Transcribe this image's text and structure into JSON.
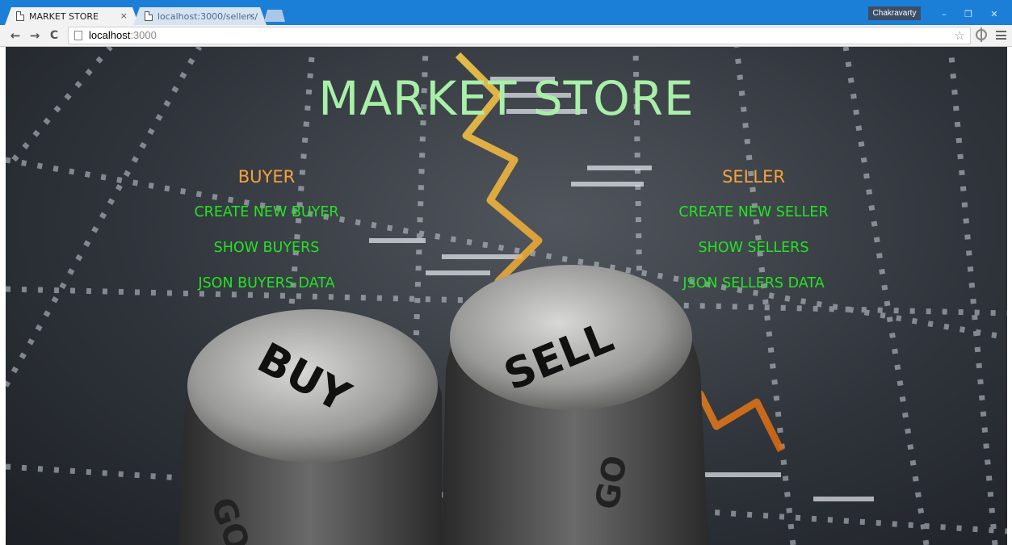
{
  "browser": {
    "tabs": [
      {
        "title": "MARKET STORE",
        "close": "×",
        "active": true
      },
      {
        "title": "localhost:3000/sellers/",
        "close": "×",
        "active": false
      }
    ],
    "profile_name": "Chakravarty",
    "window_controls": {
      "minimize": "–",
      "restore": "❐",
      "close": "✕"
    },
    "nav": {
      "back": "←",
      "forward": "→",
      "reload": "C"
    },
    "address": {
      "host": "localhost",
      "port": ":3000"
    },
    "bookmark_star": "☆",
    "icons": [
      "page-icon",
      "extension-icon",
      "menu-icon"
    ]
  },
  "page": {
    "title": "MARKET STORE",
    "buyer": {
      "heading": "BUYER",
      "links": [
        "CREATE NEW BUYER",
        "SHOW BUYERS",
        "JSON BUYERS DATA"
      ]
    },
    "seller": {
      "heading": "SELLER",
      "links": [
        "CREATE NEW SELLER",
        "SHOW SELLERS",
        "JSON SELLERS DATA"
      ]
    },
    "dice_labels": {
      "left": "BUY",
      "right": "SELL",
      "left_side": "GO",
      "right_side": "GO"
    }
  },
  "colors": {
    "title": "#a8f0a8",
    "heading": "#f7a23a",
    "link": "#22e422",
    "chrome_blue": "#1b7fd8"
  }
}
